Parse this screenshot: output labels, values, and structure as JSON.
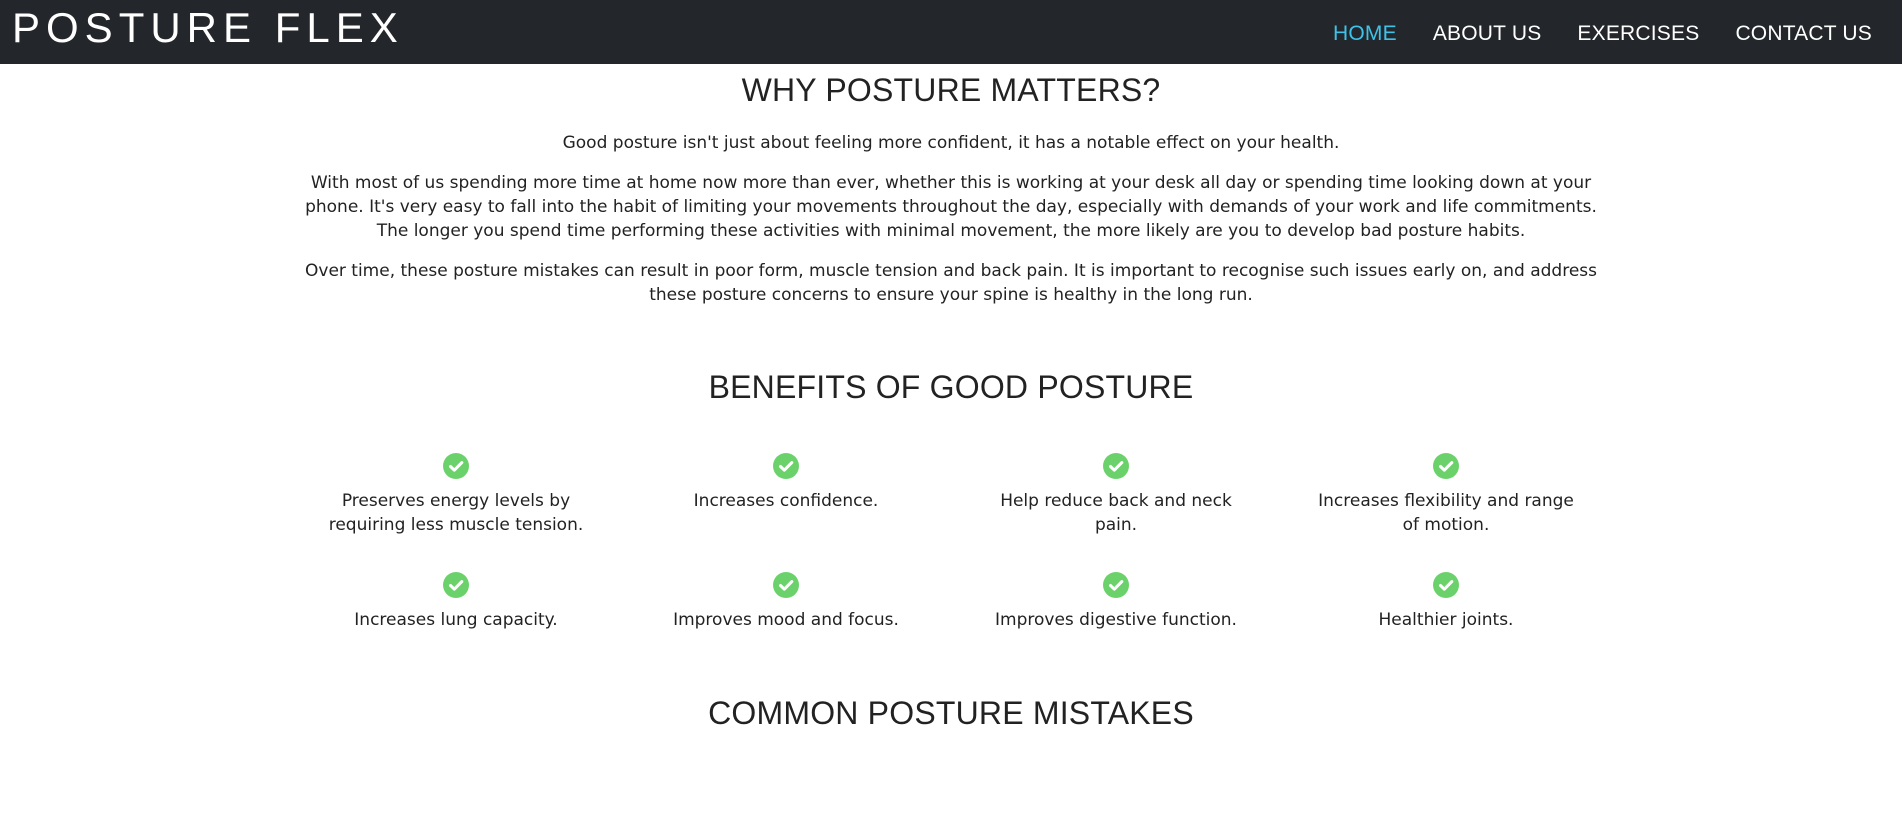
{
  "nav": {
    "brand": "POSTURE FLEX",
    "links": [
      {
        "label": "HOME",
        "active": true
      },
      {
        "label": "ABOUT US",
        "active": false
      },
      {
        "label": "EXERCISES",
        "active": false
      },
      {
        "label": "CONTACT US",
        "active": false
      }
    ],
    "active_color": "#3fc1e8",
    "bar_color": "#23272b"
  },
  "why": {
    "title": "WHY POSTURE MATTERS?",
    "paragraphs": [
      "Good posture isn't just about feeling more confident, it has a notable effect on your health.",
      "With most of us spending more time at home now more than ever, whether this is working at your desk all day or spending time looking down at your phone. It's very easy to fall into the habit of limiting your movements throughout the day, especially with demands of your work and life commitments. The longer you spend time performing these activities with minimal movement, the more likely are you to develop bad posture habits.",
      "Over time, these posture mistakes can result in poor form, muscle tension and back pain. It is important to recognise such issues early on, and address these posture concerns to ensure your spine is healthy in the long run."
    ]
  },
  "benefits": {
    "title": "BENEFITS OF GOOD POSTURE",
    "icon": "check-circle-icon",
    "icon_color": "#6bd26b",
    "items": [
      "Preserves energy levels by requiring less muscle tension.",
      "Increases confidence.",
      "Help reduce back and neck pain.",
      "Increases flexibility and range of motion.",
      "Increases lung capacity.",
      "Improves mood and focus.",
      "Improves digestive function.",
      "Healthier joints."
    ]
  },
  "mistakes": {
    "title": "COMMON POSTURE MISTAKES"
  }
}
